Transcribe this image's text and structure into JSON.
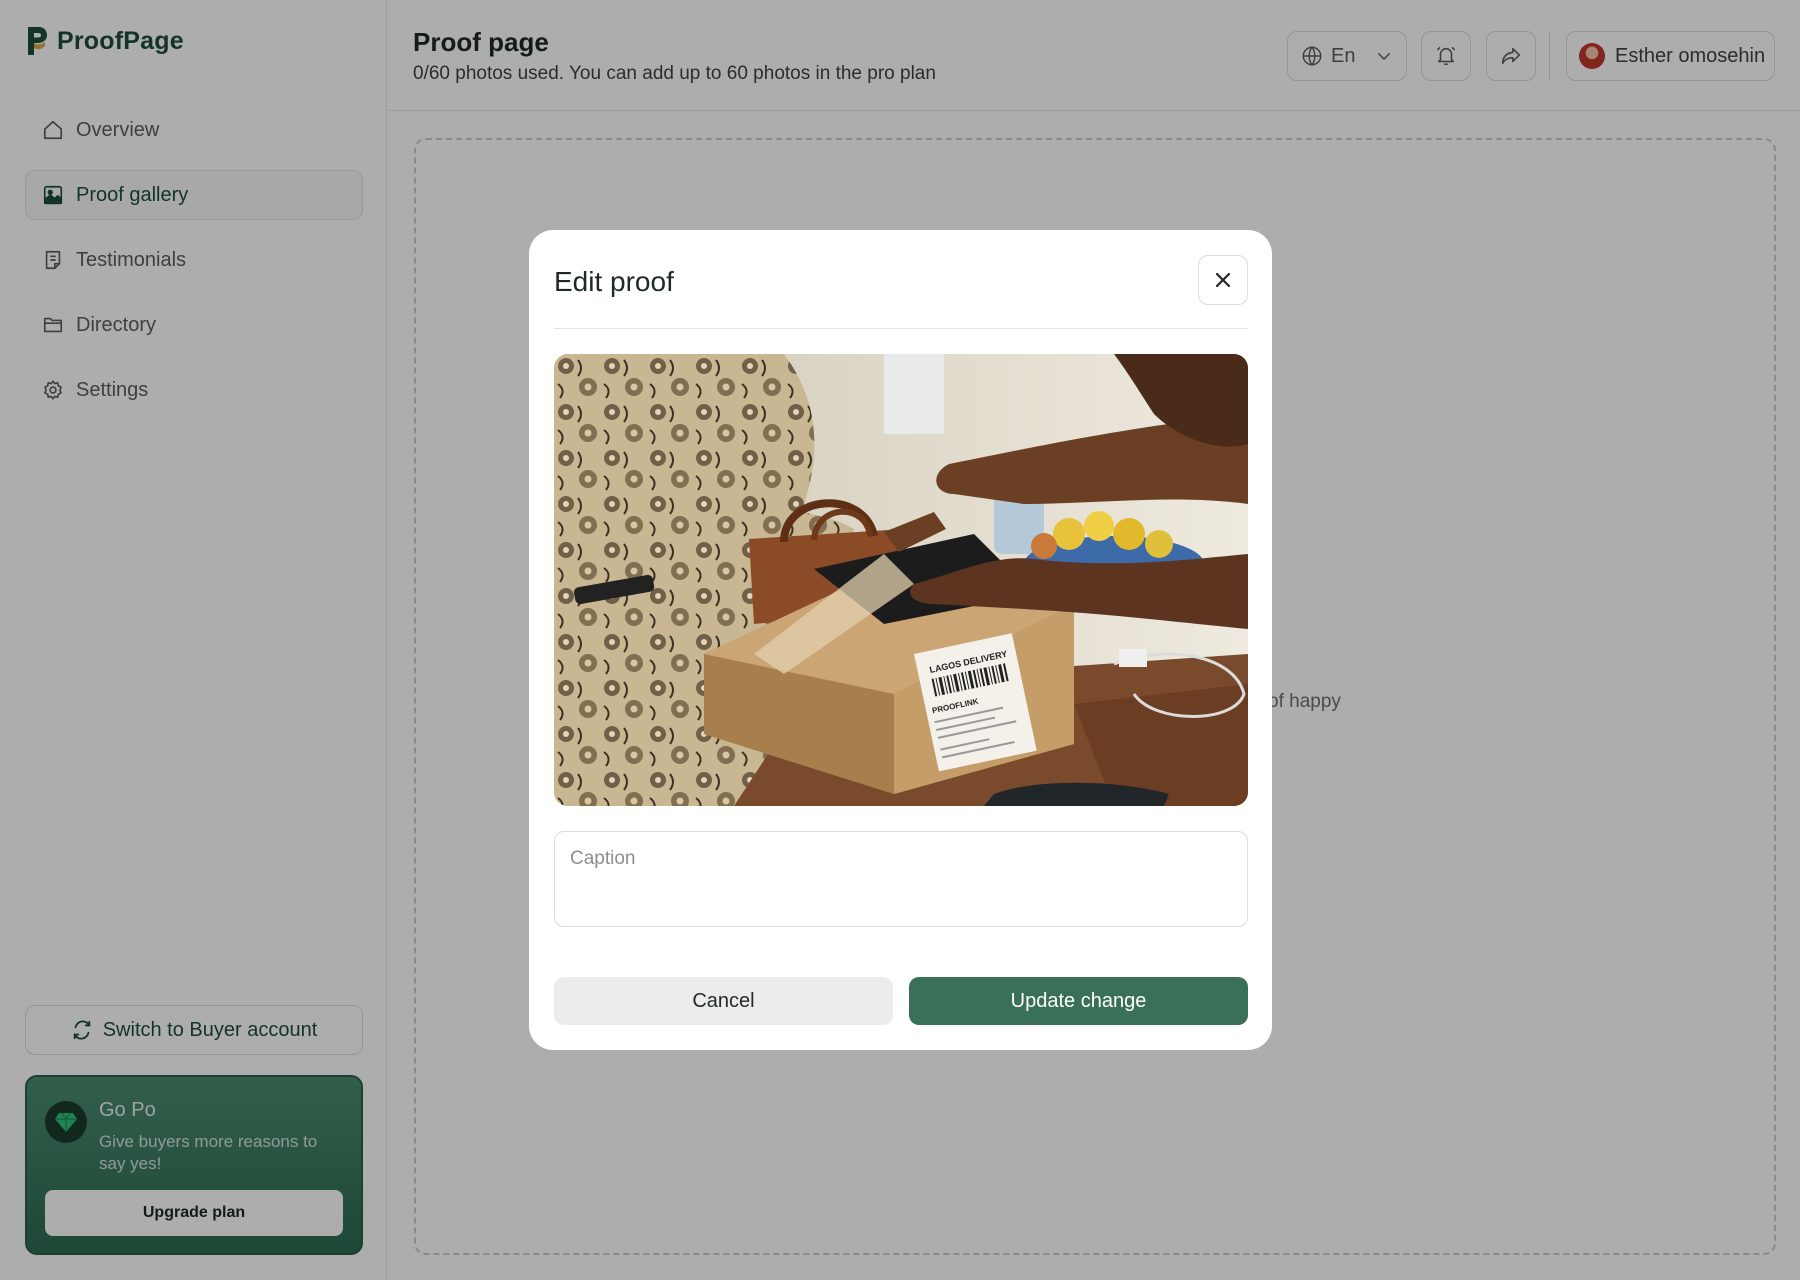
{
  "app": {
    "name": "ProofPage"
  },
  "sidebar": {
    "items": [
      {
        "label": "Overview",
        "icon": "home-icon",
        "active": false
      },
      {
        "label": "Proof gallery",
        "icon": "gallery-icon",
        "active": true
      },
      {
        "label": "Testimonials",
        "icon": "document-icon",
        "active": false
      },
      {
        "label": "Directory",
        "icon": "folder-icon",
        "active": false
      },
      {
        "label": "Settings",
        "icon": "gear-icon",
        "active": false
      }
    ],
    "switch_label": "Switch to Buyer account",
    "promo": {
      "title": "Go Po",
      "subtitle": "Give buyers more reasons to say yes!",
      "button_label": "Upgrade plan"
    }
  },
  "header": {
    "title": "Proof page",
    "subtitle": "0/60 photos used. You can add up to 60 photos in the pro plan",
    "language": "En",
    "user_name": "Esther omosehin"
  },
  "main": {
    "empty_text_fragment": "of happy"
  },
  "modal": {
    "title": "Edit proof",
    "caption_placeholder": "Caption",
    "caption_value": "",
    "cancel_label": "Cancel",
    "update_label": "Update change",
    "box_label_1": "LAGOS DELIVERY",
    "box_label_2": "PROOFLINK"
  },
  "colors": {
    "brand": "#1e4d3a",
    "primary_button": "#3a7058",
    "promo_gradient_top": "#4a8c6f",
    "promo_gradient_bottom": "#2c6a50"
  }
}
